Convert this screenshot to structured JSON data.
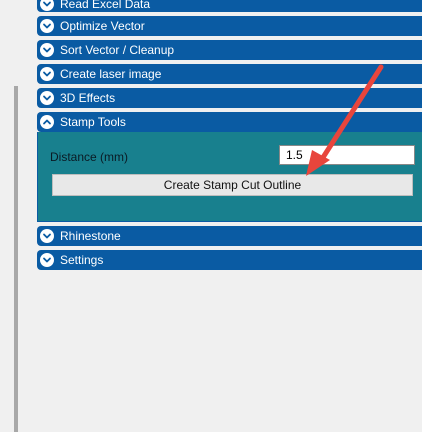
{
  "sections": {
    "read_excel": "Read Excel Data",
    "optimize_vector": "Optimize Vector",
    "sort_vector": "Sort Vector / Cleanup",
    "create_laser": "Create laser image",
    "effects_3d": "3D Effects",
    "stamp_tools": "Stamp Tools",
    "rhinestone": "Rhinestone",
    "settings": "Settings"
  },
  "stamp": {
    "distance_label": "Distance (mm)",
    "distance_value": "1.5",
    "create_button": "Create Stamp Cut Outline"
  },
  "colors": {
    "header": "#0a5ba3",
    "expanded_body": "#18808e",
    "annotation_arrow": "#e8453c"
  }
}
